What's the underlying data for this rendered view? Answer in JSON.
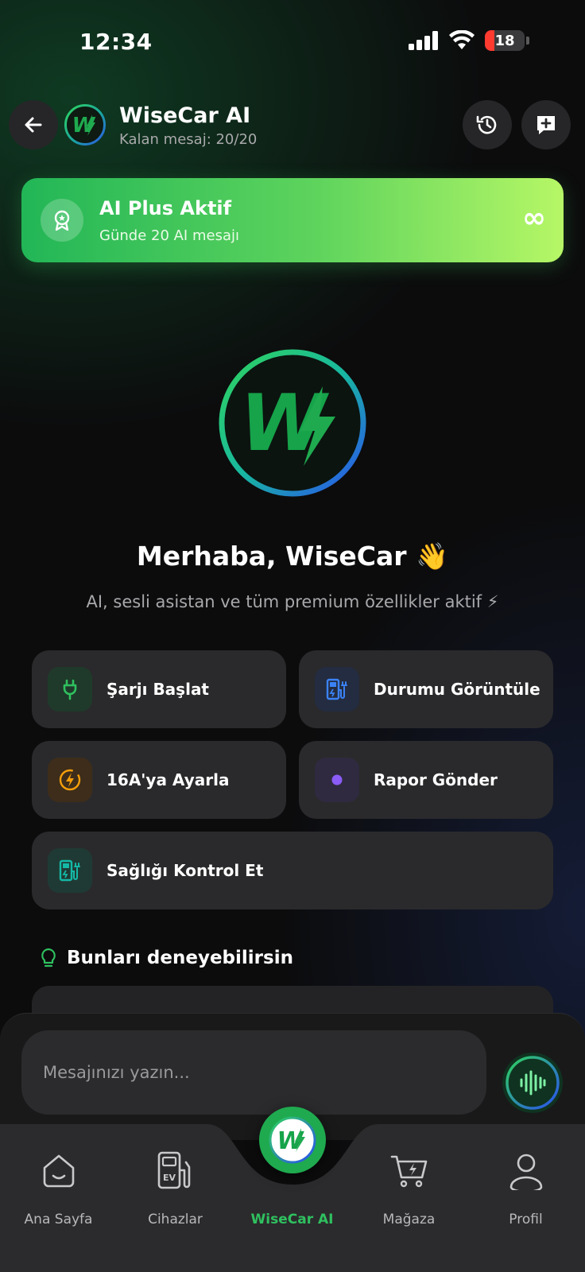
{
  "status_bar": {
    "time": "12:34",
    "battery": "18"
  },
  "header": {
    "title": "WiseCar AI",
    "subtitle": "Kalan mesaj: 20/20"
  },
  "banner": {
    "title": "AI Plus Aktif",
    "subtitle": "Günde 20 AI mesajı",
    "badge": "∞"
  },
  "hero": {
    "greeting": "Merhaba, WiseCar 👋",
    "tagline": "AI, sesli asistan ve tüm premium özellikler aktif ⚡"
  },
  "actions": [
    {
      "label": "Şarjı Başlat",
      "icon": "plug-icon"
    },
    {
      "label": "Durumu Görüntüle",
      "icon": "charger-icon"
    },
    {
      "label": "16A'ya Ayarla",
      "icon": "bolt-circle-icon"
    },
    {
      "label": "Rapor Gönder",
      "icon": "dot-icon"
    },
    {
      "label": "Sağlığı Kontrol Et",
      "icon": "charger-icon"
    }
  ],
  "suggestions": {
    "title": "Bunları deneyebilirsin"
  },
  "composer": {
    "placeholder": "Mesajınızı yazın..."
  },
  "tabs": [
    {
      "label": "Ana Sayfa",
      "icon": "home-icon"
    },
    {
      "label": "Cihazlar",
      "icon": "ev-charger-icon"
    },
    {
      "label": "WiseCar AI",
      "icon": "wisecar-logo-icon"
    },
    {
      "label": "Mağaza",
      "icon": "cart-icon"
    },
    {
      "label": "Profil",
      "icon": "profile-icon"
    }
  ],
  "colors": {
    "accent": "#2fc05f",
    "card": "#2a2a2c",
    "background": "#0c0c0d"
  }
}
